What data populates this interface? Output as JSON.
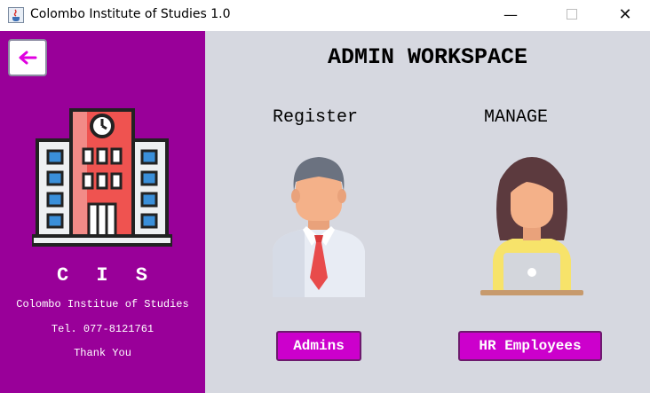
{
  "window": {
    "title": "Colombo Institute of Studies 1.0",
    "minimize": "—",
    "close": "✕"
  },
  "sidebar": {
    "back_icon": "arrow-left-icon",
    "logo_icon": "building-icon",
    "brand": "C I S",
    "institute_name": "Colombo Institue of Studies",
    "telephone": "Tel. 077-8121761",
    "thanks": "Thank You"
  },
  "main": {
    "title": "ADMIN WORKSPACE",
    "register_label": "Register",
    "manage_label": "MANAGE",
    "admins_button": "Admins",
    "hr_button": "HR Employees"
  },
  "colors": {
    "sidebar_bg": "#990099",
    "main_bg": "#d6d8e0",
    "button_bg": "#cc00cc",
    "arrow": "#e000e0"
  }
}
